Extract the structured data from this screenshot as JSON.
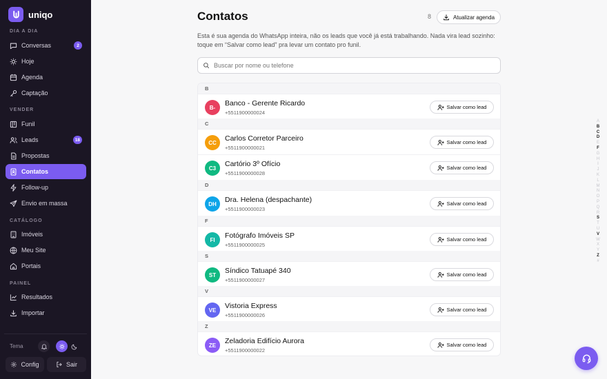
{
  "app": {
    "name": "uniqo"
  },
  "sidebar": {
    "sections": {
      "dia_a_dia": "DIA A DIA",
      "vender": "VENDER",
      "catalogo": "CATÁLOGO",
      "painel": "PAINEL"
    },
    "items": [
      {
        "label": "Conversas",
        "icon": "chat-icon",
        "badge": "2"
      },
      {
        "label": "Hoje",
        "icon": "sun-icon"
      },
      {
        "label": "Agenda",
        "icon": "calendar-icon"
      },
      {
        "label": "Captação",
        "icon": "key-icon"
      },
      {
        "label": "Funil",
        "icon": "kanban-icon"
      },
      {
        "label": "Leads",
        "icon": "users-icon",
        "badge": "18"
      },
      {
        "label": "Propostas",
        "icon": "document-icon"
      },
      {
        "label": "Contatos",
        "icon": "contacts-icon",
        "active": true
      },
      {
        "label": "Follow-up",
        "icon": "bolt-icon"
      },
      {
        "label": "Envio em massa",
        "icon": "send-icon"
      },
      {
        "label": "Imóveis",
        "icon": "building-icon"
      },
      {
        "label": "Meu Site",
        "icon": "globe-icon"
      },
      {
        "label": "Portais",
        "icon": "portal-icon"
      },
      {
        "label": "Resultados",
        "icon": "chart-icon"
      },
      {
        "label": "Importar",
        "icon": "download-icon"
      }
    ],
    "theme_label": "Tema",
    "config_label": "Config",
    "logout_label": "Sair"
  },
  "main": {
    "title": "Contatos",
    "count": "8",
    "export_label": "Atualizar agenda",
    "description": "Esta é sua agenda do WhatsApp inteira, não os leads que você já está trabalhando. Nada vira lead sozinho: toque em “Salvar como lead” pra levar um contato pro funil.",
    "search_placeholder": "Buscar por nome ou telefone",
    "save_label": "Salvar como lead",
    "groups": [
      {
        "letter": "B",
        "contacts": [
          {
            "initials": "B-",
            "name": "Banco - Gerente Ricardo",
            "phone": "+5511900000024",
            "color": "#e8405f"
          }
        ]
      },
      {
        "letter": "C",
        "contacts": [
          {
            "initials": "CC",
            "name": "Carlos Corretor Parceiro",
            "phone": "+5511900000021",
            "color": "#f59e0b"
          },
          {
            "initials": "C3",
            "name": "Cartório 3º Ofício",
            "phone": "+5511900000028",
            "color": "#10b981"
          }
        ]
      },
      {
        "letter": "D",
        "contacts": [
          {
            "initials": "DH",
            "name": "Dra. Helena (despachante)",
            "phone": "+5511900000023",
            "color": "#0ea5e9"
          }
        ]
      },
      {
        "letter": "F",
        "contacts": [
          {
            "initials": "FI",
            "name": "Fotógrafo Imóveis SP",
            "phone": "+5511900000025",
            "color": "#14b8a6"
          }
        ]
      },
      {
        "letter": "S",
        "contacts": [
          {
            "initials": "ST",
            "name": "Síndico Tatuapé 340",
            "phone": "+5511900000027",
            "color": "#10b981"
          }
        ]
      },
      {
        "letter": "V",
        "contacts": [
          {
            "initials": "VE",
            "name": "Vistoria Express",
            "phone": "+5511900000026",
            "color": "#6366f1"
          }
        ]
      },
      {
        "letter": "Z",
        "contacts": [
          {
            "initials": "ZE",
            "name": "Zeladoria Edifício Aurora",
            "phone": "+5511900000022",
            "color": "#8b5cf6"
          }
        ]
      }
    ],
    "alphabet": [
      "A",
      "B",
      "C",
      "D",
      "E",
      "F",
      "G",
      "H",
      "I",
      "J",
      "K",
      "L",
      "M",
      "N",
      "O",
      "P",
      "Q",
      "R",
      "S",
      "T",
      "U",
      "V",
      "W",
      "X",
      "Y",
      "Z",
      "#"
    ],
    "alphabet_active": [
      "B",
      "C",
      "D",
      "F",
      "S",
      "V",
      "Z"
    ]
  },
  "colors": {
    "accent": "#7b5cf0",
    "sidebar_bg": "#1b1624"
  },
  "support_button": {
    "icon": "headset-icon"
  }
}
